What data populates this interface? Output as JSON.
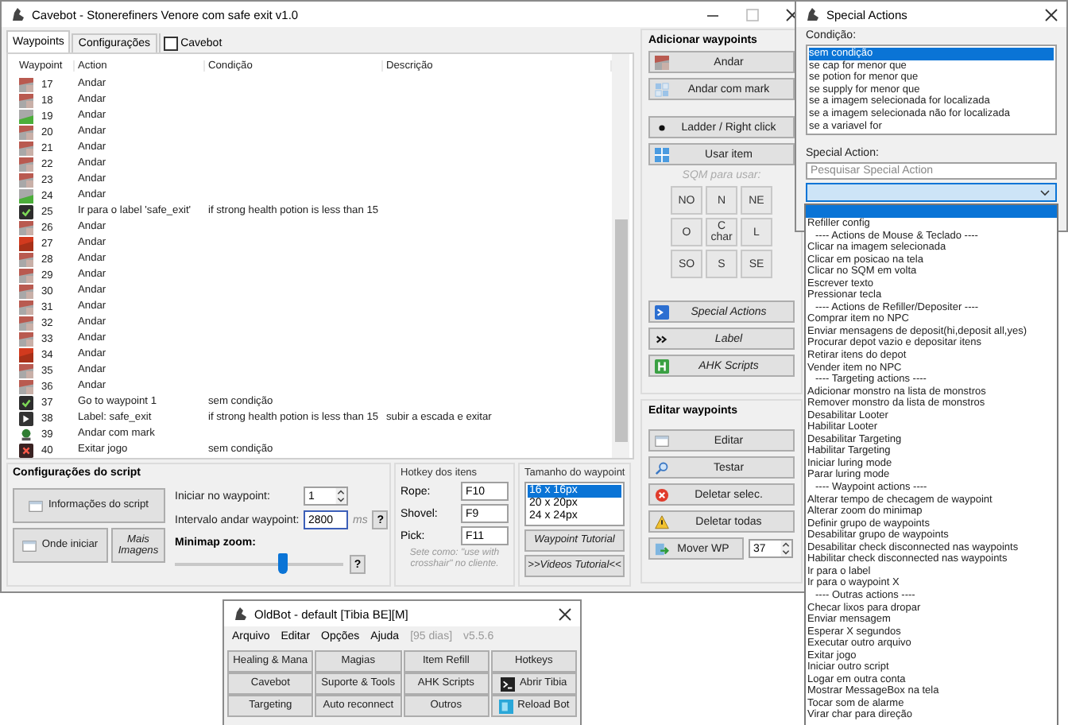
{
  "main_window": {
    "title": "Cavebot - Stonerefiners Venore com safe exit v1.0",
    "tabs": [
      {
        "label": "Waypoints",
        "selected": true
      },
      {
        "label": "Configurações",
        "selected": false
      }
    ],
    "cavebot_toggle": {
      "label": "Cavebot",
      "checked": false
    },
    "table": {
      "columns": [
        "Waypoint",
        "Action",
        "Condição",
        "Descrição"
      ],
      "rows": [
        {
          "kind": "tile",
          "waypoint": "17",
          "action": "Andar"
        },
        {
          "kind": "tile",
          "waypoint": "18",
          "action": "Andar"
        },
        {
          "kind": "tile-green",
          "waypoint": "19",
          "action": "Andar"
        },
        {
          "kind": "tile",
          "waypoint": "20",
          "action": "Andar"
        },
        {
          "kind": "tile",
          "waypoint": "21",
          "action": "Andar"
        },
        {
          "kind": "tile",
          "waypoint": "22",
          "action": "Andar"
        },
        {
          "kind": "tile",
          "waypoint": "23",
          "action": "Andar"
        },
        {
          "kind": "tile-green",
          "waypoint": "24",
          "action": "Andar"
        },
        {
          "kind": "check",
          "waypoint": "25",
          "action": "Ir para o label 'safe_exit'",
          "condition": "if strong health potion is less than 15"
        },
        {
          "kind": "tile",
          "waypoint": "26",
          "action": "Andar"
        },
        {
          "kind": "tile-red",
          "waypoint": "27",
          "action": "Andar"
        },
        {
          "kind": "tile",
          "waypoint": "28",
          "action": "Andar"
        },
        {
          "kind": "tile",
          "waypoint": "29",
          "action": "Andar"
        },
        {
          "kind": "tile",
          "waypoint": "30",
          "action": "Andar"
        },
        {
          "kind": "tile",
          "waypoint": "31",
          "action": "Andar"
        },
        {
          "kind": "tile",
          "waypoint": "32",
          "action": "Andar"
        },
        {
          "kind": "tile",
          "waypoint": "33",
          "action": "Andar"
        },
        {
          "kind": "tile-red",
          "waypoint": "34",
          "action": "Andar"
        },
        {
          "kind": "tile",
          "waypoint": "35",
          "action": "Andar"
        },
        {
          "kind": "tile",
          "waypoint": "36",
          "action": "Andar"
        },
        {
          "kind": "check",
          "waypoint": "37",
          "action": "Go to waypoint 1",
          "condition": "sem condição"
        },
        {
          "kind": "label",
          "waypoint": "38",
          "action": "Label: safe_exit",
          "condition": "if strong health potion is less than 15",
          "description": "subir a escada e exitar"
        },
        {
          "kind": "mark",
          "waypoint": "39",
          "action": "Andar com mark"
        },
        {
          "kind": "exit",
          "waypoint": "40",
          "action": "Exitar jogo",
          "condition": "sem condição"
        }
      ]
    },
    "add_waypoints": {
      "title": "Adicionar waypoints",
      "walk_buttons": [
        {
          "label": "Andar",
          "kind": "tile"
        },
        {
          "label": "Andar com mark",
          "kind": "grid"
        }
      ],
      "item_buttons": [
        {
          "label": "Ladder / Right click",
          "kind": "dot"
        },
        {
          "label": "Usar item",
          "kind": "grid-blue"
        }
      ],
      "sqm_hint": "SQM para usar:",
      "directions": [
        "NO",
        "N",
        "NE",
        "O",
        "C char",
        "L",
        "SO",
        "S",
        "SE"
      ],
      "action_buttons": [
        {
          "label": "Special Actions",
          "kind": "terminal"
        },
        {
          "label": "Label",
          "kind": "chevrons"
        },
        {
          "label": "AHK Scripts",
          "kind": "script"
        }
      ]
    },
    "edit_waypoints": {
      "title": "Editar waypoints",
      "buttons": [
        {
          "label": "Editar",
          "kind": "window"
        },
        {
          "label": "Testar",
          "kind": "search"
        },
        {
          "label": "Deletar selec.",
          "kind": "delete"
        },
        {
          "label": "Deletar todas",
          "kind": "warning"
        }
      ],
      "move": {
        "label": "Mover WP",
        "kind": "move",
        "value": "37"
      }
    },
    "script_config": {
      "title": "Configurações do script",
      "info_button": "Informações do script",
      "start_button": "Onde iniciar",
      "images_button": "Mais Imagens",
      "start_label": "Iniciar no waypoint:",
      "start_value": "1",
      "interval_label": "Intervalo andar waypoint:",
      "interval_value": "2800",
      "interval_unit": "ms",
      "help": "?",
      "zoom_label": "Minimap zoom:",
      "zoom": {
        "level": 0.64
      },
      "zoom_help": "?"
    },
    "hotkeys": {
      "title": "Hotkey dos itens",
      "items": [
        {
          "label": "Rope:",
          "value": "F10"
        },
        {
          "label": "Shovel:",
          "value": "F9"
        },
        {
          "label": "Pick:",
          "value": "F11"
        }
      ],
      "note": "Sete como: \"use with crosshair\" no cliente."
    },
    "waypoint_size": {
      "title": "Tamanho do waypoint",
      "options": [
        {
          "label": "16 x 16px",
          "selected": true
        },
        {
          "label": "20 x 20px",
          "selected": false
        },
        {
          "label": "24 x 24px",
          "selected": false
        }
      ],
      "tutorial_button": "Waypoint Tutorial",
      "videos_button": ">>Videos Tutorial<<"
    }
  },
  "special_actions": {
    "title": "Special Actions",
    "condition_label": "Condição:",
    "conditions": [
      {
        "label": "sem condição",
        "selected": true
      },
      {
        "label": "se cap for menor que",
        "selected": false
      },
      {
        "label": "se potion for menor que",
        "selected": false
      },
      {
        "label": "se supply for menor que",
        "selected": false
      },
      {
        "label": "se a imagem selecionada for localizada",
        "selected": false
      },
      {
        "label": "se a imagem selecionada não for localizada",
        "selected": false
      },
      {
        "label": "se a variavel for",
        "selected": false
      }
    ],
    "action_label": "Special Action:",
    "search": {
      "placeholder": "Pesquisar Special Action"
    },
    "dropdown_options": [
      {
        "label": "Refiller config",
        "kind": "option"
      },
      {
        "label": "---- Actions de Mouse & Teclado ----",
        "kind": "header"
      },
      {
        "label": "Clicar na imagem selecionada",
        "kind": "option"
      },
      {
        "label": "Clicar em posicao na tela",
        "kind": "option"
      },
      {
        "label": "Clicar no SQM em volta",
        "kind": "option"
      },
      {
        "label": "Escrever texto",
        "kind": "option"
      },
      {
        "label": "Pressionar tecla",
        "kind": "option"
      },
      {
        "label": "---- Actions de Refiller/Depositer ----",
        "kind": "header"
      },
      {
        "label": "Comprar item no NPC",
        "kind": "option"
      },
      {
        "label": "Enviar mensagens de deposit(hi,deposit all,yes)",
        "kind": "option"
      },
      {
        "label": "Procurar depot vazio e depositar itens",
        "kind": "option"
      },
      {
        "label": "Retirar itens do depot",
        "kind": "option"
      },
      {
        "label": "Vender item no NPC",
        "kind": "option"
      },
      {
        "label": "---- Targeting actions ----",
        "kind": "header"
      },
      {
        "label": "Adicionar monstro na lista de monstros",
        "kind": "option"
      },
      {
        "label": "Remover monstro da lista de monstros",
        "kind": "option"
      },
      {
        "label": "Desabilitar Looter",
        "kind": "option"
      },
      {
        "label": "Habilitar Looter",
        "kind": "option"
      },
      {
        "label": "Desabilitar Targeting",
        "kind": "option"
      },
      {
        "label": "Habilitar Targeting",
        "kind": "option"
      },
      {
        "label": "Iniciar luring mode",
        "kind": "option"
      },
      {
        "label": "Parar luring mode",
        "kind": "option"
      },
      {
        "label": "---- Waypoint actions ----",
        "kind": "header"
      },
      {
        "label": "Alterar tempo de checagem de waypoint",
        "kind": "option"
      },
      {
        "label": "Alterar zoom do minimap",
        "kind": "option"
      },
      {
        "label": "Definir grupo de waypoints",
        "kind": "option"
      },
      {
        "label": "Desabilitar grupo de waypoints",
        "kind": "option"
      },
      {
        "label": "Desabilitar check disconnected nas waypoints",
        "kind": "option"
      },
      {
        "label": "Habilitar check disconnected nas waypoints",
        "kind": "option"
      },
      {
        "label": "Ir para o label",
        "kind": "option"
      },
      {
        "label": "Ir para o waypoint X",
        "kind": "option"
      },
      {
        "label": "---- Outras actions ----",
        "kind": "header"
      },
      {
        "label": "Checar lixos para dropar",
        "kind": "option"
      },
      {
        "label": "Enviar mensagem",
        "kind": "option"
      },
      {
        "label": "Esperar X segundos",
        "kind": "option"
      },
      {
        "label": "Executar outro arquivo",
        "kind": "option"
      },
      {
        "label": "Exitar jogo",
        "kind": "option"
      },
      {
        "label": "Iniciar outro script",
        "kind": "option"
      },
      {
        "label": "Logar em outra conta",
        "kind": "option"
      },
      {
        "label": "Mostrar MessageBox na tela",
        "kind": "option"
      },
      {
        "label": "Tocar som de alarme",
        "kind": "option"
      },
      {
        "label": "Virar char para direção",
        "kind": "option"
      }
    ]
  },
  "oldbot": {
    "title": "OldBot - default [Tibia BE][M]",
    "menu": [
      "Arquivo",
      "Editar",
      "Opções",
      "Ajuda"
    ],
    "days": "[95 dias]",
    "version": "v5.5.6",
    "buttons": [
      {
        "label": "Healing & Mana",
        "kind": "plain"
      },
      {
        "label": "Magias",
        "kind": "plain"
      },
      {
        "label": "Item Refill",
        "kind": "plain"
      },
      {
        "label": "Hotkeys",
        "kind": "plain"
      },
      {
        "label": "Cavebot",
        "kind": "plain"
      },
      {
        "label": "Suporte & Tools",
        "kind": "plain"
      },
      {
        "label": "AHK Scripts",
        "kind": "plain"
      },
      {
        "label": "Abrir Tibia",
        "kind": "terminal-dark"
      },
      {
        "label": "Targeting",
        "kind": "plain"
      },
      {
        "label": "Auto reconnect",
        "kind": "plain"
      },
      {
        "label": "Outros",
        "kind": "plain"
      },
      {
        "label": "Reload Bot",
        "kind": "reload"
      }
    ]
  }
}
